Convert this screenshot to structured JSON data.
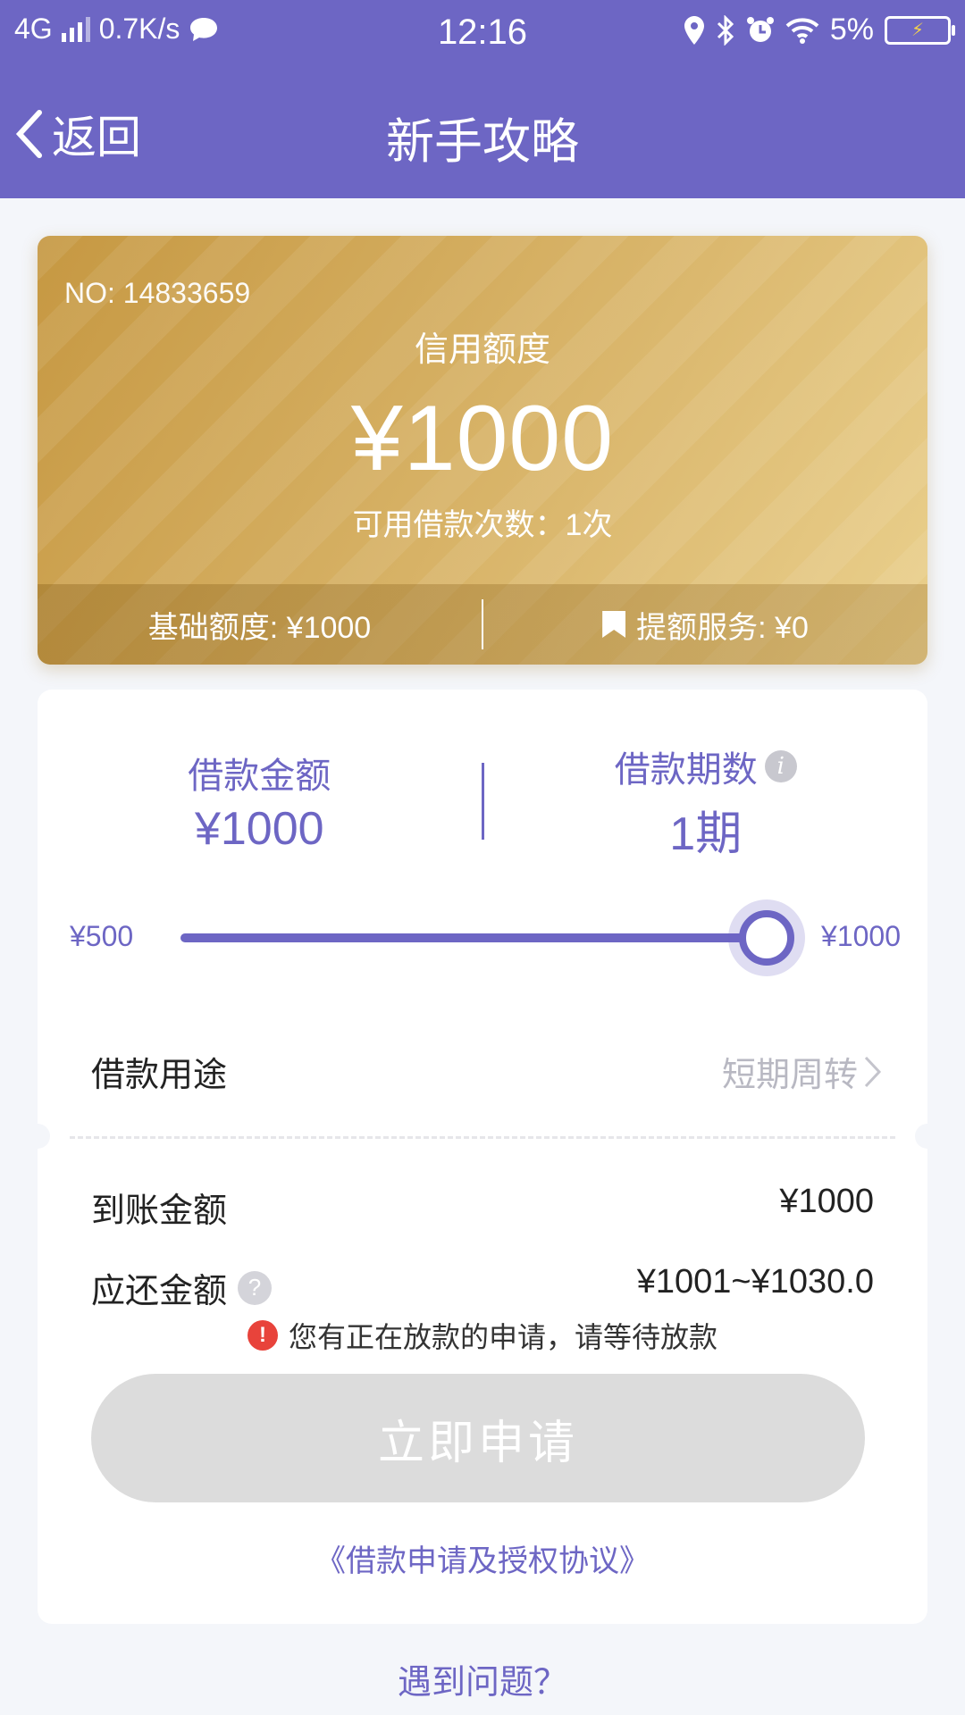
{
  "status_bar": {
    "network": "4G",
    "speed": "0.7K/s",
    "time": "12:16",
    "battery": "5%"
  },
  "header": {
    "back_label": "返回",
    "title": "新手攻略"
  },
  "credit_card": {
    "number": "NO: 14833659",
    "label": "信用额度",
    "amount": "¥1000",
    "available_times": "可用借款次数：1次",
    "base_quota": "基础额度: ¥1000",
    "upgrade_service": "提额服务: ¥0"
  },
  "loan": {
    "amount_label": "借款金额",
    "amount_value": "¥1000",
    "period_label": "借款期数",
    "period_value": "1期",
    "slider": {
      "min_label": "¥500",
      "max_label": "¥1000",
      "min": 500,
      "max": 1000,
      "value": 1000
    },
    "purpose_label": "借款用途",
    "purpose_value": "短期周转",
    "arrival_label": "到账金额",
    "arrival_value": "¥1000",
    "repay_label": "应还金额",
    "repay_value": "¥1001~¥1030.0",
    "warning": "您有正在放款的申请，请等待放款",
    "apply_button": "立即申请",
    "agreement": "《借款申请及授权协议》"
  },
  "help_link": "遇到问题？",
  "colors": {
    "primary": "#6d66c4",
    "gold": "#d9b56a",
    "warning": "#e8433b",
    "disabled_button": "#dcdcdc"
  }
}
